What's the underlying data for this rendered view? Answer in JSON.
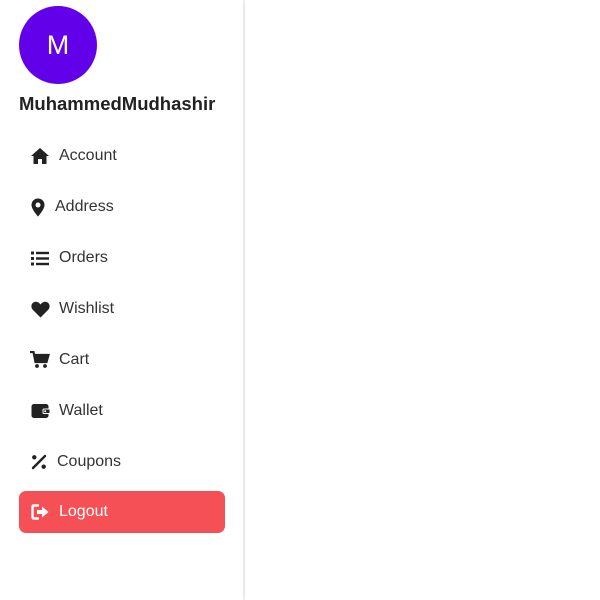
{
  "profile": {
    "avatar_initial": "M",
    "username": "MuhammedMudhashir",
    "avatar_color": "#6200ea"
  },
  "menu": {
    "items": [
      {
        "label": "Account",
        "icon": "home-icon"
      },
      {
        "label": "Address",
        "icon": "map-pin-icon"
      },
      {
        "label": "Orders",
        "icon": "list-icon"
      },
      {
        "label": "Wishlist",
        "icon": "heart-icon"
      },
      {
        "label": "Cart",
        "icon": "cart-icon"
      },
      {
        "label": "Wallet",
        "icon": "wallet-icon"
      },
      {
        "label": "Coupons",
        "icon": "percent-icon"
      }
    ],
    "logout": {
      "label": "Logout",
      "icon": "logout-icon",
      "color": "#f55055"
    }
  }
}
